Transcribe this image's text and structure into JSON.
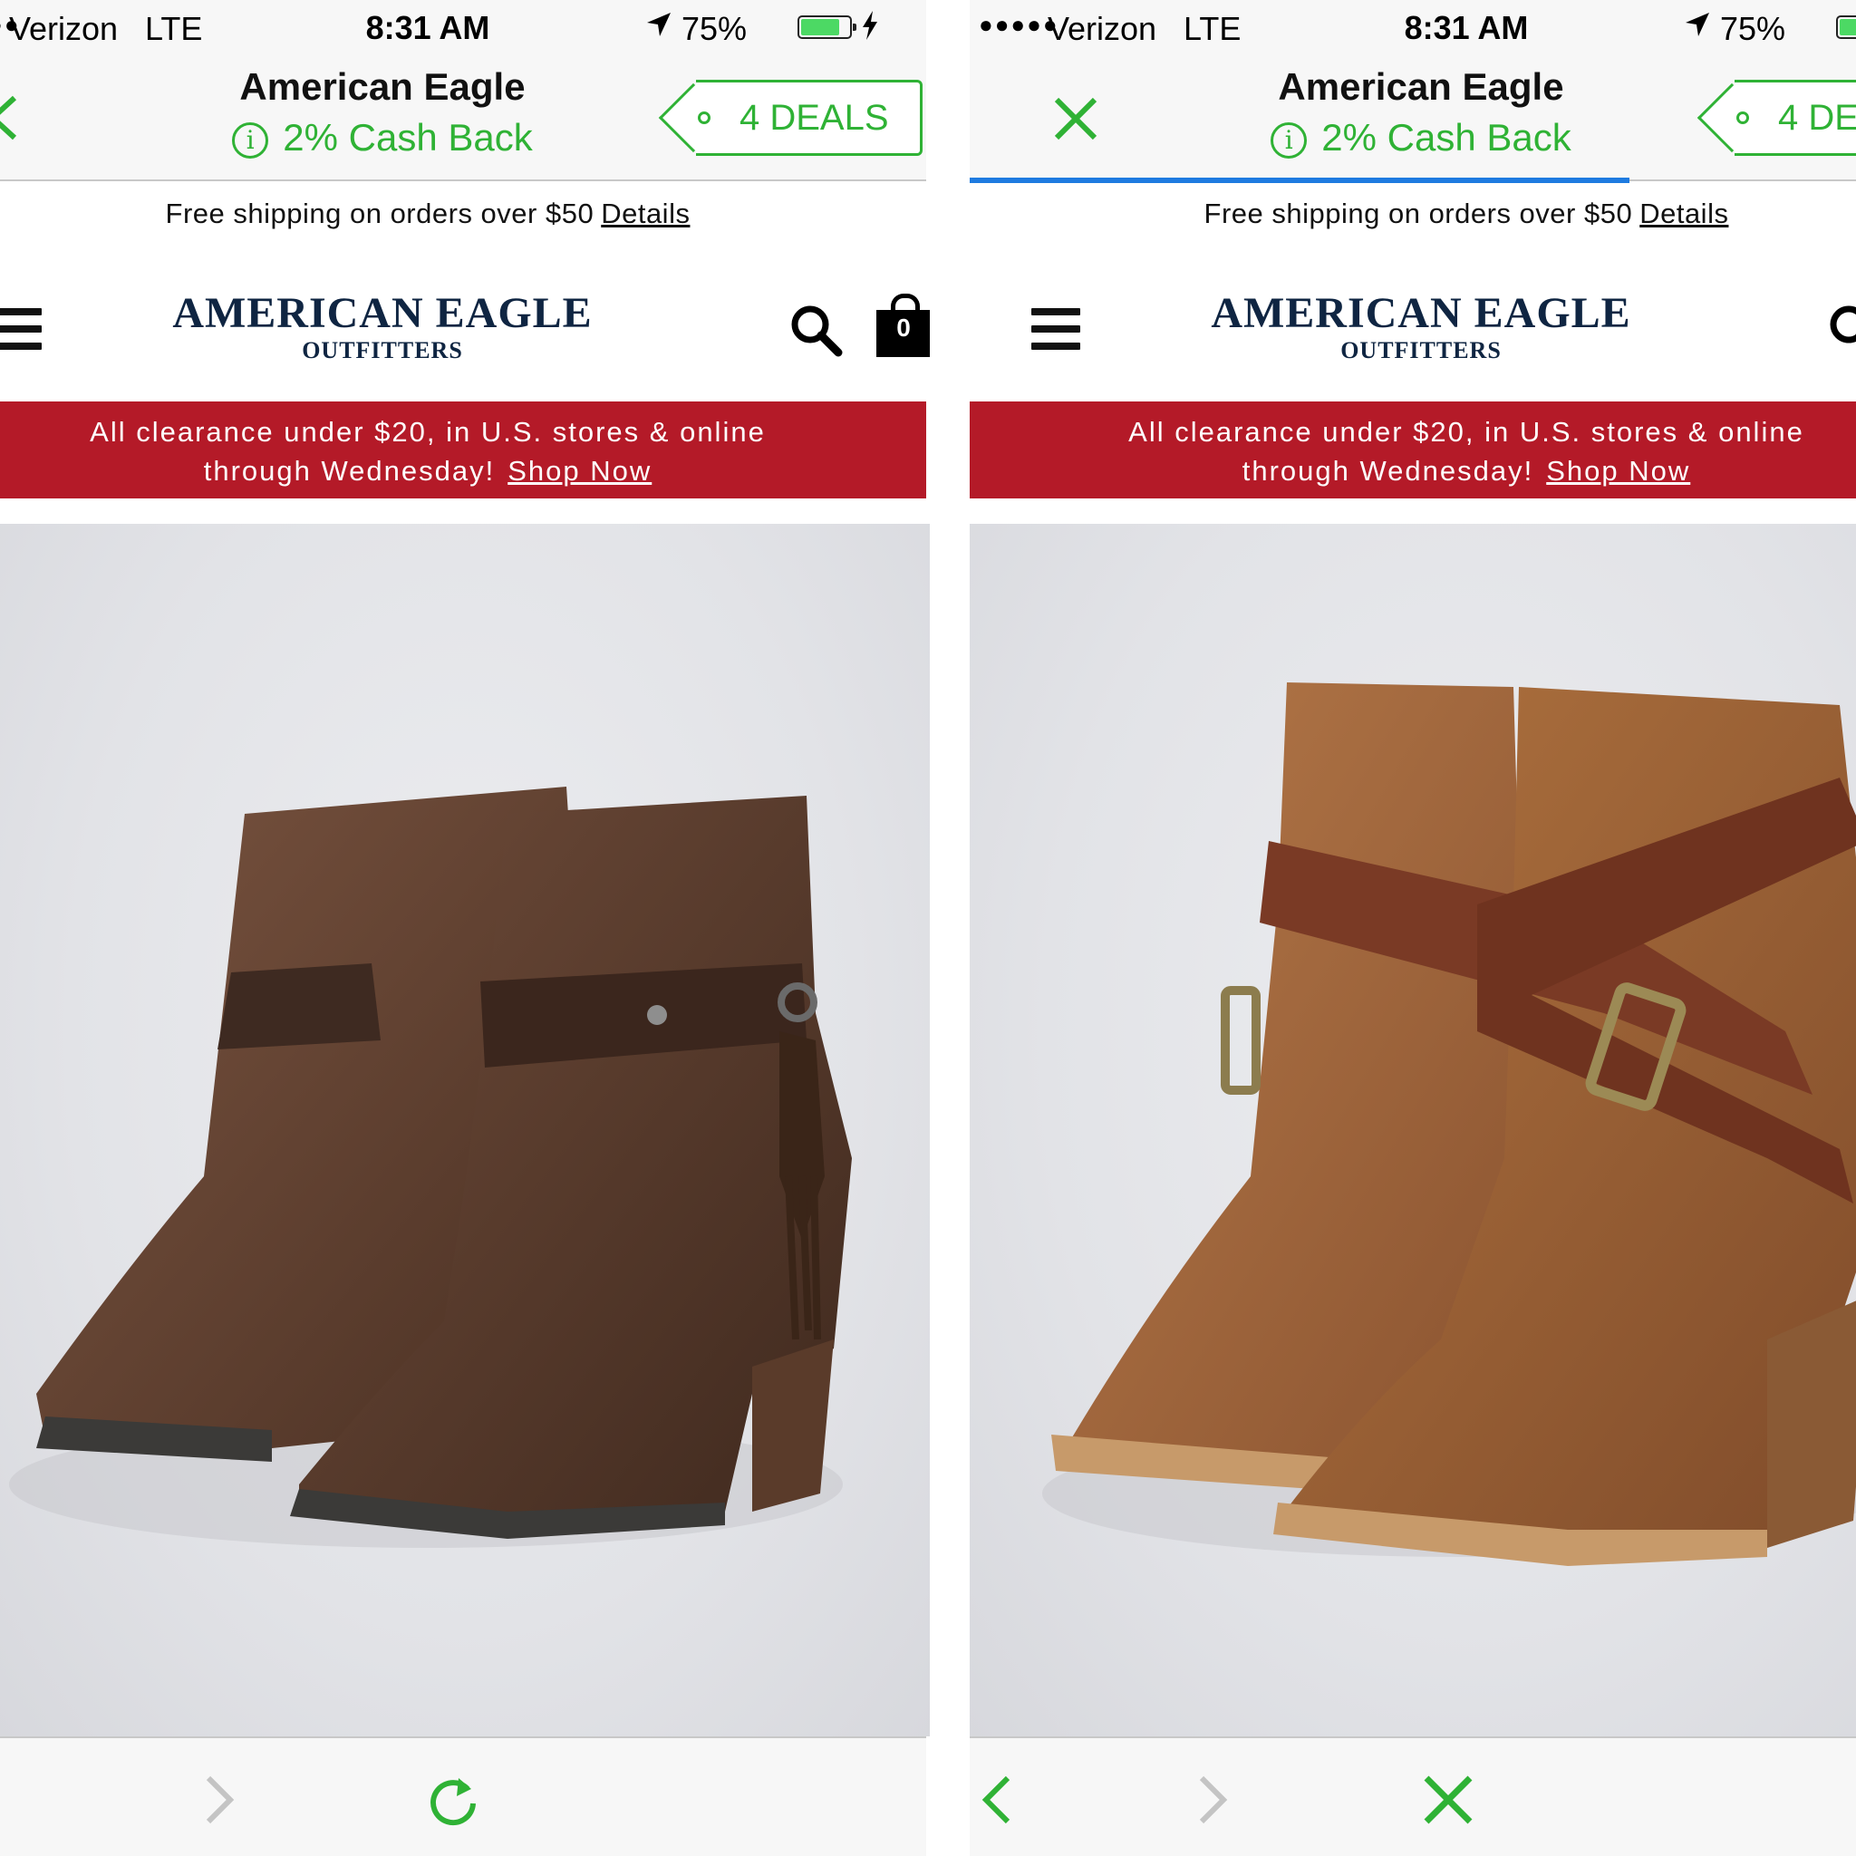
{
  "status_bar": {
    "carrier": "Verizon",
    "network": "LTE",
    "time": "8:31 AM",
    "battery_percent": "75%",
    "battery_level": 0.75
  },
  "extension_bar": {
    "store_name": "American Eagle",
    "cashback": "2% Cash Back",
    "deals": "4 DEALS",
    "accent_color": "#2fb235"
  },
  "site": {
    "shipping_text": "Free shipping on orders over $50",
    "shipping_link": "Details",
    "logo_line1": "AMERICAN EAGLE",
    "logo_line2": "OUTFITTERS",
    "cart_count": "0",
    "promo_line1": "All clearance under $20, in U.S. stores & online",
    "promo_line2": "through Wednesday!",
    "promo_link": "Shop Now",
    "promo_color": "#b41a28",
    "logo_color": "#0f2542"
  },
  "panes": {
    "left": {
      "product_image": "dark-brown-ankle-boots"
    },
    "right": {
      "product_image": "cognac-strap-ankle-boots"
    }
  },
  "icons": [
    "back-icon",
    "close-icon",
    "info-icon",
    "tag-icon",
    "menu-icon",
    "search-icon",
    "bag-icon",
    "forward-icon",
    "reload-icon"
  ]
}
